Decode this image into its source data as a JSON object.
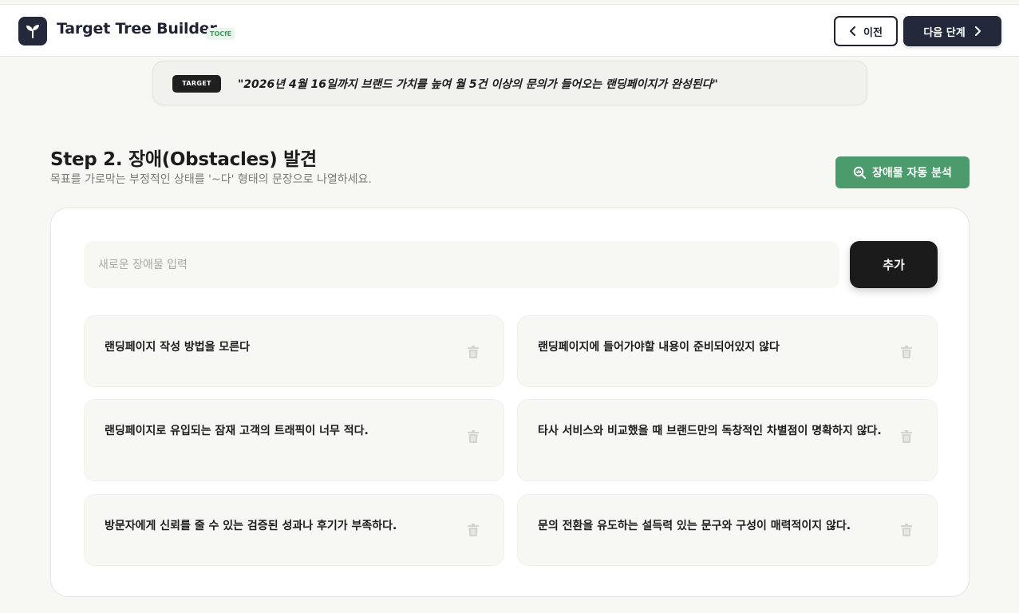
{
  "header": {
    "app_title": "Target Tree Builder",
    "badge": "TOCfE",
    "prev_label": "이전",
    "next_label": "다음 단계",
    "logo_icon": "sprout-icon"
  },
  "target": {
    "tag": "TARGET",
    "text": "\"2026년 4월 16일까지 브랜드 가치를 높여 월 5건 이상의 문의가 들어오는 랜딩페이지가 완성된다\""
  },
  "step": {
    "title": "Step 2. 장애(Obstacles) 발견",
    "description": "목표를 가로막는 부정적인 상태를 '~다' 형태의 문장으로 나열하세요.",
    "analyze_label": "장애물 자동 분석"
  },
  "input": {
    "placeholder": "새로운 장애물 입력",
    "value": "",
    "add_label": "추가"
  },
  "obstacles": [
    "랜딩페이지 작성 방법을 모른다",
    "랜딩페이지에 들어가야할 내용이 준비되어있지 않다",
    "랜딩페이지로 유입되는 잠재 고객의 트래픽이 너무 적다.",
    "타사 서비스와 비교했을 때 브랜드만의 독창적인 차별점이 명확하지 않다.",
    "방문자에게 신뢰를 줄 수 있는 검증된 성과나 후기가 부족하다.",
    "문의 전환을 유도하는 설득력 있는 문구와 구성이 매력적이지 않다."
  ],
  "colors": {
    "accent_dark": "#23283a",
    "analyze_green": "#4c9b6c",
    "background": "#f7f7f4"
  }
}
